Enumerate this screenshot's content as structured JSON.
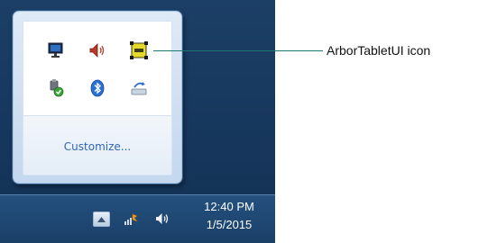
{
  "popup": {
    "icons": [
      {
        "name": "network-monitor-icon"
      },
      {
        "name": "volume-icon"
      },
      {
        "name": "arbor-tablet-ui-icon"
      },
      {
        "name": "usb-device-check-icon"
      },
      {
        "name": "bluetooth-icon"
      },
      {
        "name": "safely-remove-hardware-icon"
      }
    ],
    "customize_label": "Customize..."
  },
  "callout": {
    "label": "ArborTabletUI icon",
    "line_color": "#1a7a72"
  },
  "taskbar": {
    "time": "12:40 PM",
    "date": "1/5/2015",
    "tray_icons": [
      "show-hidden-icons-arrow",
      "action-center-flag-icon",
      "volume-icon"
    ]
  },
  "colors": {
    "taskbar": "#1c3f66",
    "link": "#2f66b3"
  }
}
